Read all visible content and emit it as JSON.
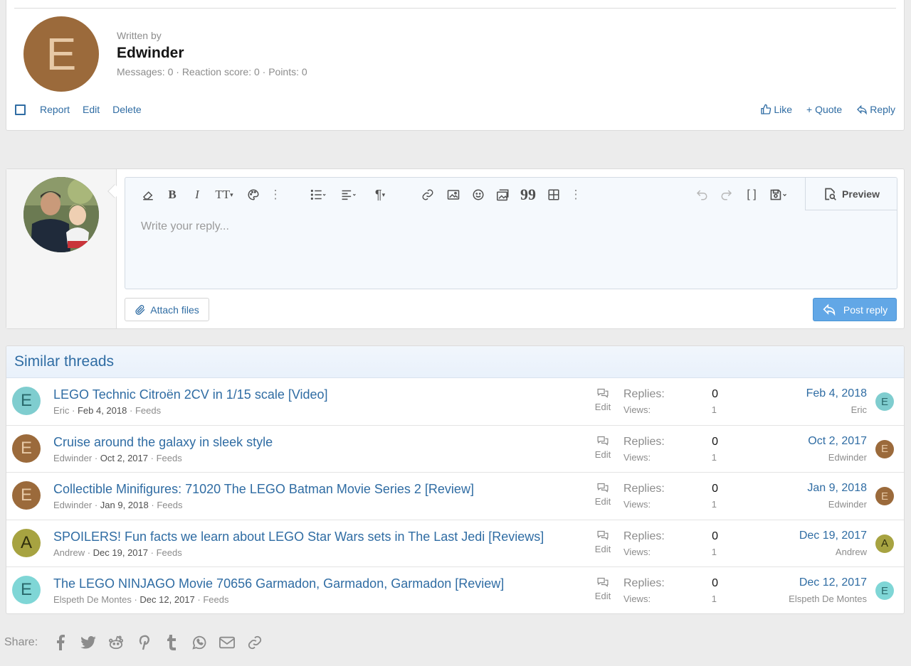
{
  "author": {
    "avatar_letter": "E",
    "avatar_bg": "#9b6a3b",
    "written_by": "Written by",
    "name": "Edwinder",
    "stats": "Messages: 0 · Reaction score: 0 · Points: 0"
  },
  "post_actions": {
    "report": "Report",
    "edit": "Edit",
    "delete": "Delete",
    "like": "Like",
    "quote": "+ Quote",
    "reply": "Reply"
  },
  "reply_box": {
    "placeholder": "Write your reply...",
    "preview": "Preview",
    "attach_files": "Attach files",
    "post_reply": "Post reply",
    "toolbar_icons": [
      "eraser-icon",
      "bold-icon",
      "italic-icon",
      "text-size-icon",
      "palette-icon",
      "more-vertical-icon",
      "list-icon",
      "align-icon",
      "paragraph-icon",
      "link-icon",
      "image-icon",
      "smilie-icon",
      "media-icon",
      "quote-icon",
      "table-icon",
      "more-vertical-icon",
      "undo-icon",
      "redo-icon",
      "bbcode-icon",
      "drafts-icon"
    ]
  },
  "similar_threads": {
    "title": "Similar threads",
    "replies_label": "Replies:",
    "views_label": "Views:",
    "edit_label": "Edit",
    "threads": [
      {
        "avatar_letter": "E",
        "avatar_bg": "#7fcdcf",
        "avatar_fg": "#2a6a6c",
        "title": "LEGO Technic Citroën 2CV in 1/15 scale [Video]",
        "author": "Eric",
        "date": "Feb 4, 2018",
        "forum": "Feeds",
        "replies": "0",
        "views": "1",
        "last_date": "Feb 4, 2018",
        "last_user": "Eric"
      },
      {
        "avatar_letter": "E",
        "avatar_bg": "#9b6a3b",
        "avatar_fg": "#e7c9a6",
        "title": "Cruise around the galaxy in sleek style",
        "author": "Edwinder",
        "date": "Oct 2, 2017",
        "forum": "Feeds",
        "replies": "0",
        "views": "1",
        "last_date": "Oct 2, 2017",
        "last_user": "Edwinder"
      },
      {
        "avatar_letter": "E",
        "avatar_bg": "#9b6a3b",
        "avatar_fg": "#e7c9a6",
        "title": "Collectible Minifigures: 71020 The LEGO Batman Movie Series 2 [Review]",
        "author": "Edwinder",
        "date": "Jan 9, 2018",
        "forum": "Feeds",
        "replies": "0",
        "views": "1",
        "last_date": "Jan 9, 2018",
        "last_user": "Edwinder"
      },
      {
        "avatar_letter": "A",
        "avatar_bg": "#a7a341",
        "avatar_fg": "#2f2e0d",
        "title": "SPOILERS! Fun facts we learn about LEGO Star Wars sets in The Last Jedi [Reviews]",
        "author": "Andrew",
        "date": "Dec 19, 2017",
        "forum": "Feeds",
        "replies": "0",
        "views": "1",
        "last_date": "Dec 19, 2017",
        "last_user": "Andrew"
      },
      {
        "avatar_letter": "E",
        "avatar_bg": "#7fd6d6",
        "avatar_fg": "#2a6a6c",
        "title": "The LEGO NINJAGO Movie 70656 Garmadon, Garmadon, Garmadon [Review]",
        "author": "Elspeth De Montes",
        "date": "Dec 12, 2017",
        "forum": "Feeds",
        "replies": "0",
        "views": "1",
        "last_date": "Dec 12, 2017",
        "last_user": "Elspeth De Montes"
      }
    ]
  },
  "share": {
    "label": "Share:",
    "icons": [
      "facebook-icon",
      "twitter-icon",
      "reddit-icon",
      "pinterest-icon",
      "tumblr-icon",
      "whatsapp-icon",
      "email-icon",
      "link-icon"
    ]
  }
}
